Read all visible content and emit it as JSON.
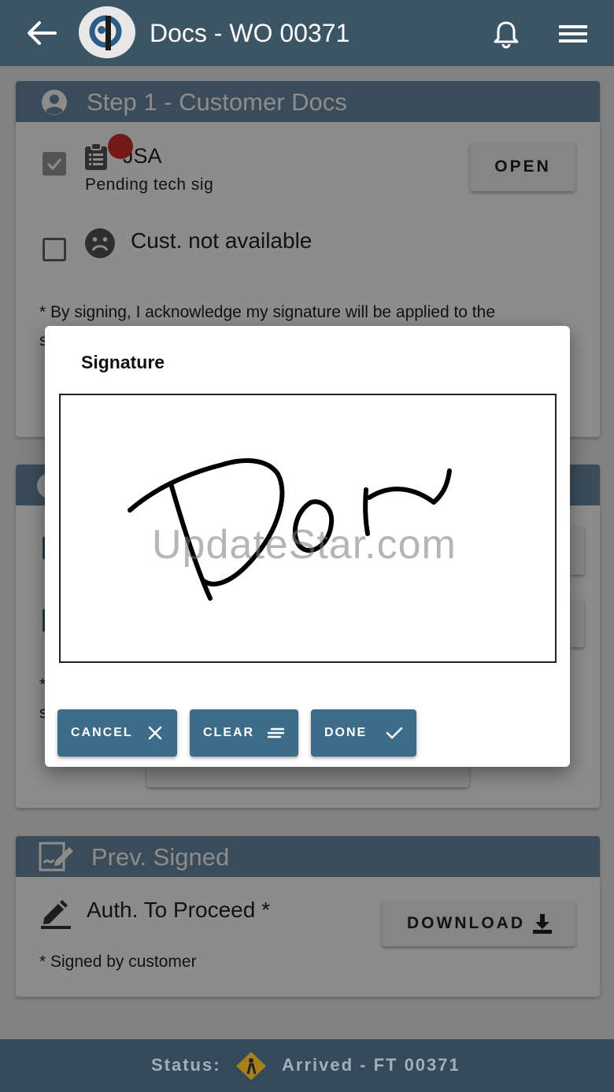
{
  "appbar": {
    "title": "Docs - WO 00371"
  },
  "step1": {
    "title": "Step 1 - Customer Docs",
    "jsa": {
      "label": "JSA",
      "sub": "Pending tech sig",
      "open_label": "OPEN"
    },
    "cust_unavailable": "Cust. not available",
    "ack": "* By signing, I acknowledge my signature will be applied to the",
    "ack_cut": "s"
  },
  "step2": {
    "frag1": "*",
    "frag2": "s"
  },
  "prev_signed": {
    "title": "Prev. Signed",
    "item_label": "Auth. To Proceed *",
    "download_label": "DOWNLOAD",
    "note": "* Signed by customer"
  },
  "status": {
    "label": "Status:",
    "value": "Arrived - FT 00371"
  },
  "dialog": {
    "title": "Signature",
    "watermark": "UpdateStar.com",
    "cancel_label": "CANCEL",
    "clear_label": "CLEAR",
    "done_label": "DONE"
  },
  "colors": {
    "appbar": "#3c5565",
    "card_header": "#6a8aa2",
    "dialog_button": "#3d6c89",
    "status_bar": "#34495a",
    "badge": "#d32f2f"
  },
  "icons": [
    "back-arrow-icon",
    "bell-icon",
    "menu-icon",
    "person-icon",
    "clipboard-icon",
    "sad-face-icon",
    "signature-doc-icon",
    "pencil-icon",
    "download-icon",
    "warning-person-icon",
    "close-icon",
    "lines-icon",
    "check-icon"
  ]
}
